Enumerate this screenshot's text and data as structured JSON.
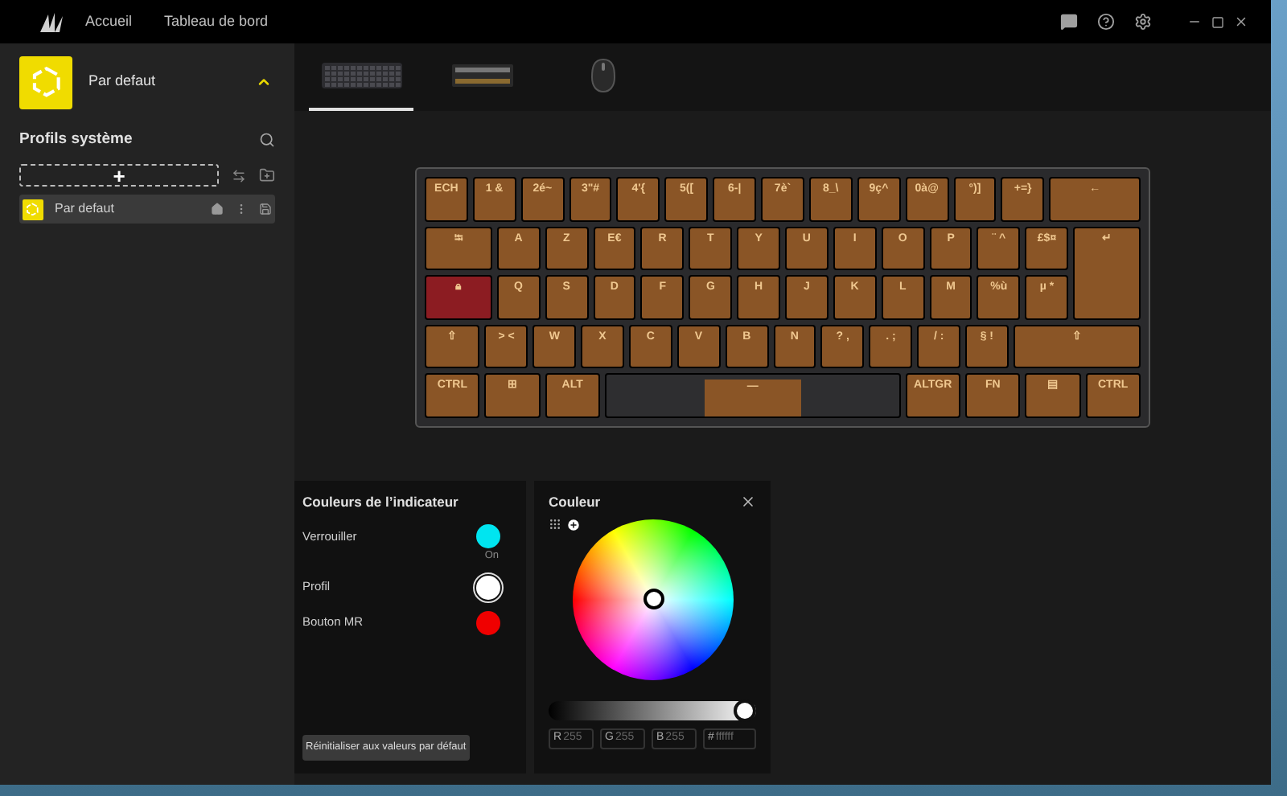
{
  "titlebar": {
    "nav": [
      "Accueil",
      "Tableau de bord"
    ]
  },
  "sidebar": {
    "current_profile": "Par defaut",
    "expanded": true,
    "section_title": "Profils système",
    "add_label": "+",
    "profiles": [
      {
        "name": "Par defaut",
        "selected": true
      }
    ]
  },
  "devices": [
    {
      "kind": "keyboard",
      "selected": true
    },
    {
      "kind": "memory",
      "selected": false
    },
    {
      "kind": "mouse",
      "selected": false
    }
  ],
  "keyboard": {
    "rows": [
      [
        {
          "label": "ECH",
          "color": "#8a5526"
        },
        {
          "label": "1 &",
          "color": "#8a5526"
        },
        {
          "label": "2é~",
          "color": "#8a5526"
        },
        {
          "label": "3\"#",
          "color": "#8a5526"
        },
        {
          "label": "4'{",
          "color": "#8a5526"
        },
        {
          "label": "5([",
          "color": "#8a5526"
        },
        {
          "label": "6-|",
          "color": "#8a5526"
        },
        {
          "label": "7è`",
          "color": "#8a5526"
        },
        {
          "label": "8_\\",
          "color": "#8a5526"
        },
        {
          "label": "9ç^",
          "color": "#8a5526"
        },
        {
          "label": "0à@",
          "color": "#8a5526"
        },
        {
          "label": "°)]",
          "color": "#8a5526"
        },
        {
          "label": "+=}",
          "color": "#8a5526"
        },
        {
          "label": "←",
          "color": "#8a5526"
        }
      ],
      [
        {
          "label": "⭾",
          "color": "#8a5526"
        },
        {
          "label": "A",
          "color": "#8a5526"
        },
        {
          "label": "Z",
          "color": "#8a5526"
        },
        {
          "label": "E€",
          "color": "#8a5526"
        },
        {
          "label": "R",
          "color": "#8a5526"
        },
        {
          "label": "T",
          "color": "#8a5526"
        },
        {
          "label": "Y",
          "color": "#8a5526"
        },
        {
          "label": "U",
          "color": "#8a5526"
        },
        {
          "label": "I",
          "color": "#8a5526"
        },
        {
          "label": "O",
          "color": "#8a5526"
        },
        {
          "label": "P",
          "color": "#8a5526"
        },
        {
          "label": "¨ ^",
          "color": "#8a5526"
        },
        {
          "label": "£$¤",
          "color": "#8a5526"
        },
        {
          "label": "↵",
          "color": "#8a5526"
        }
      ],
      [
        {
          "label": "🔒︎",
          "color": "#8c1c22"
        },
        {
          "label": "Q",
          "color": "#8a5526"
        },
        {
          "label": "S",
          "color": "#8a5526"
        },
        {
          "label": "D",
          "color": "#8a5526"
        },
        {
          "label": "F",
          "color": "#8a5526"
        },
        {
          "label": "G",
          "color": "#8a5526"
        },
        {
          "label": "H",
          "color": "#8a5526"
        },
        {
          "label": "J",
          "color": "#8a5526"
        },
        {
          "label": "K",
          "color": "#8a5526"
        },
        {
          "label": "L",
          "color": "#8a5526"
        },
        {
          "label": "M",
          "color": "#8a5526"
        },
        {
          "label": "%ù",
          "color": "#8a5526"
        },
        {
          "label": "µ *",
          "color": "#8a5526"
        }
      ],
      [
        {
          "label": "⇧",
          "color": "#8a5526"
        },
        {
          "label": "> <",
          "color": "#8a5526"
        },
        {
          "label": "W",
          "color": "#8a5526"
        },
        {
          "label": "X",
          "color": "#8a5526"
        },
        {
          "label": "C",
          "color": "#8a5526"
        },
        {
          "label": "V",
          "color": "#8a5526"
        },
        {
          "label": "B",
          "color": "#8a5526"
        },
        {
          "label": "N",
          "color": "#8a5526"
        },
        {
          "label": "? ,",
          "color": "#8a5526"
        },
        {
          "label": ". ;",
          "color": "#8a5526"
        },
        {
          "label": "/ :",
          "color": "#8a5526"
        },
        {
          "label": "§ !",
          "color": "#8a5526"
        },
        {
          "label": "⇧",
          "color": "#8a5526"
        }
      ],
      [
        {
          "label": "CTRL",
          "color": "#8a5526"
        },
        {
          "label": "⊞",
          "color": "#8a5526"
        },
        {
          "label": "ALT",
          "color": "#8a5526"
        },
        {
          "label": "—",
          "color": "#8a5526"
        },
        {
          "label": "ALTGR",
          "color": "#8a5526"
        },
        {
          "label": "FN",
          "color": "#8a5526"
        },
        {
          "label": "▤",
          "color": "#8a5526"
        },
        {
          "label": "CTRL",
          "color": "#8a5526"
        }
      ]
    ]
  },
  "indicator_panel": {
    "title": "Couleurs de l’indicateur",
    "items": [
      {
        "label": "Verrouiller",
        "color": "#00e5f0",
        "status": "On",
        "selected": false
      },
      {
        "label": "Profil",
        "color": "#ffffff",
        "selected": true
      },
      {
        "label": "Bouton MR",
        "color": "#f00000",
        "selected": false
      }
    ],
    "reset_button": "Réinitialiser aux valeurs par défaut"
  },
  "color_panel": {
    "title": "Couleur",
    "brightness": {
      "level": 1
    },
    "fields": [
      {
        "label": "R",
        "value": "255"
      },
      {
        "label": "G",
        "value": "255"
      },
      {
        "label": "B",
        "value": "255"
      },
      {
        "label": "#",
        "value": "ffffff"
      }
    ]
  }
}
